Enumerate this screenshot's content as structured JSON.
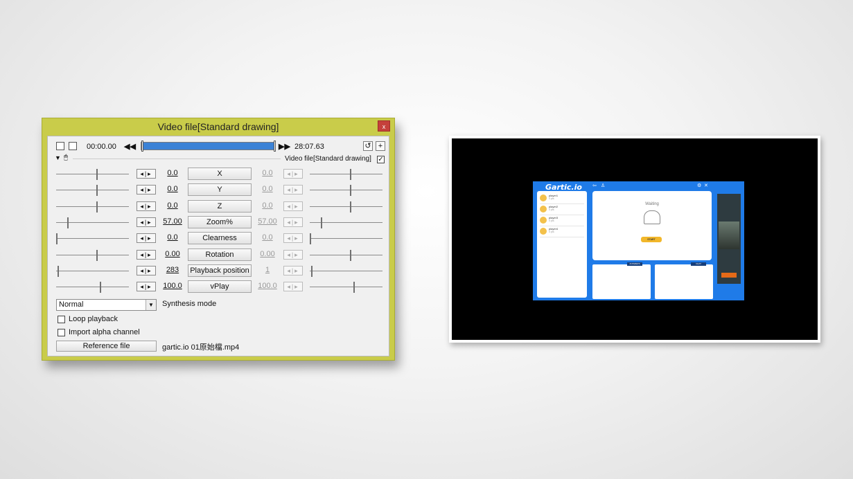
{
  "dialog": {
    "title": "Video file[Standard drawing]",
    "close_label": "x",
    "time_current": "00:00.00",
    "time_total": "28:07.63",
    "prev_label": "◀◀",
    "next_label": "▶▶",
    "seek_position": 0.0,
    "layer_label": "Video file[Standard drawing]",
    "layer_checked": "✓",
    "collapse_icon": "triangle-down-icon",
    "arrow_glyph": "◂|▸",
    "params": [
      {
        "name": "X",
        "start": "0.0",
        "end": "0.0",
        "start_pos": 0.55,
        "end_pos": 0.55
      },
      {
        "name": "Y",
        "start": "0.0",
        "end": "0.0",
        "start_pos": 0.55,
        "end_pos": 0.55
      },
      {
        "name": "Z",
        "start": "0.0",
        "end": "0.0",
        "start_pos": 0.55,
        "end_pos": 0.55
      },
      {
        "name": "Zoom%",
        "start": "57.00",
        "end": "57.00",
        "start_pos": 0.15,
        "end_pos": 0.15
      },
      {
        "name": "Clearness",
        "start": "0.0",
        "end": "0.0",
        "start_pos": 0.0,
        "end_pos": 0.0
      },
      {
        "name": "Rotation",
        "start": "0.00",
        "end": "0.00",
        "start_pos": 0.55,
        "end_pos": 0.55
      },
      {
        "name": "Playback position",
        "start": "283",
        "end": "1",
        "start_pos": 0.02,
        "end_pos": 0.02
      },
      {
        "name": "vPlay",
        "start": "100.0",
        "end": "100.0",
        "start_pos": 0.6,
        "end_pos": 0.6
      }
    ],
    "synthesis_value": "Normal",
    "synthesis_label": "Synthesis mode",
    "loop_label": "Loop playback",
    "alpha_label": "Import alpha channel",
    "reference_button": "Reference file",
    "file_name": "gartic.io 01原始檔.mp4"
  },
  "preview": {
    "logo": "Gartic.io",
    "waiting": "Waiting",
    "start": "START",
    "players": [
      {
        "name": "player1",
        "pts": "0 pts"
      },
      {
        "name": "player2",
        "pts": "0 pts"
      },
      {
        "name": "player3",
        "pts": "0 pts"
      },
      {
        "name": "player4",
        "pts": "0 pts"
      }
    ],
    "answers_label": "ANSWERS",
    "chat_label": "CHAT"
  }
}
